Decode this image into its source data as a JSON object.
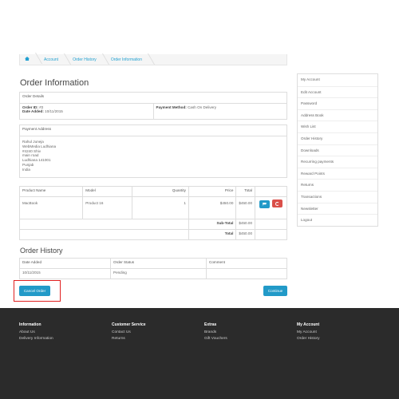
{
  "breadcrumb": {
    "items": [
      "Account",
      "Order History",
      "Order Information"
    ]
  },
  "page_title": "Order Information",
  "order_details": {
    "header": "Order Details",
    "order_id_label": "Order ID:",
    "order_id": "#2",
    "date_added_label": "Date Added:",
    "date_added": "10/11/2015",
    "payment_method_label": "Payment Method:",
    "payment_method": "Cash On Delivery"
  },
  "payment_address": {
    "header": "Payment Address",
    "lines": [
      "Rahul Juneja",
      "WebMedia Ludhiana",
      "#4240 Shiv",
      "main road",
      "Ludhiana 141001",
      "Punjab",
      "India"
    ]
  },
  "products": {
    "headers": [
      "Product Name",
      "Model",
      "Quantity",
      "Price",
      "Total"
    ],
    "row": {
      "name": "MacBook",
      "model": "Product 16",
      "quantity": "1",
      "price": "$450.00",
      "total": "$450.00"
    },
    "subtotal_label": "Sub-Total",
    "subtotal": "$450.00",
    "total_label": "Total",
    "total": "$450.00"
  },
  "history": {
    "title": "Order History",
    "headers": [
      "Date Added",
      "Order Status",
      "Comment"
    ],
    "row": {
      "date": "10/11/2015",
      "status": "Pending",
      "comment": ""
    }
  },
  "buttons": {
    "cancel": "Cancel Order",
    "continue": "Continue"
  },
  "sidebar": {
    "items": [
      "My Account",
      "Edit Account",
      "Password",
      "Address Book",
      "Wish List",
      "Order History",
      "Downloads",
      "Recurring payments",
      "Reward Points",
      "Returns",
      "Transactions",
      "Newsletter",
      "Logout"
    ]
  },
  "footer": {
    "info": {
      "title": "Information",
      "links": [
        "About Us",
        "Delivery Information"
      ]
    },
    "service": {
      "title": "Customer Service",
      "links": [
        "Contact Us",
        "Returns"
      ]
    },
    "extras": {
      "title": "Extras",
      "links": [
        "Brands",
        "Gift Vouchers"
      ]
    },
    "account": {
      "title": "My Account",
      "links": [
        "My Account",
        "Order History"
      ]
    }
  },
  "colors": {
    "accent": "#229ac8",
    "danger": "#da4f49",
    "footer_bg": "#2b2b2b",
    "highlight": "#e02020"
  },
  "icons": {
    "home": "home-icon",
    "reorder": "cart-icon",
    "return": "return-icon"
  }
}
